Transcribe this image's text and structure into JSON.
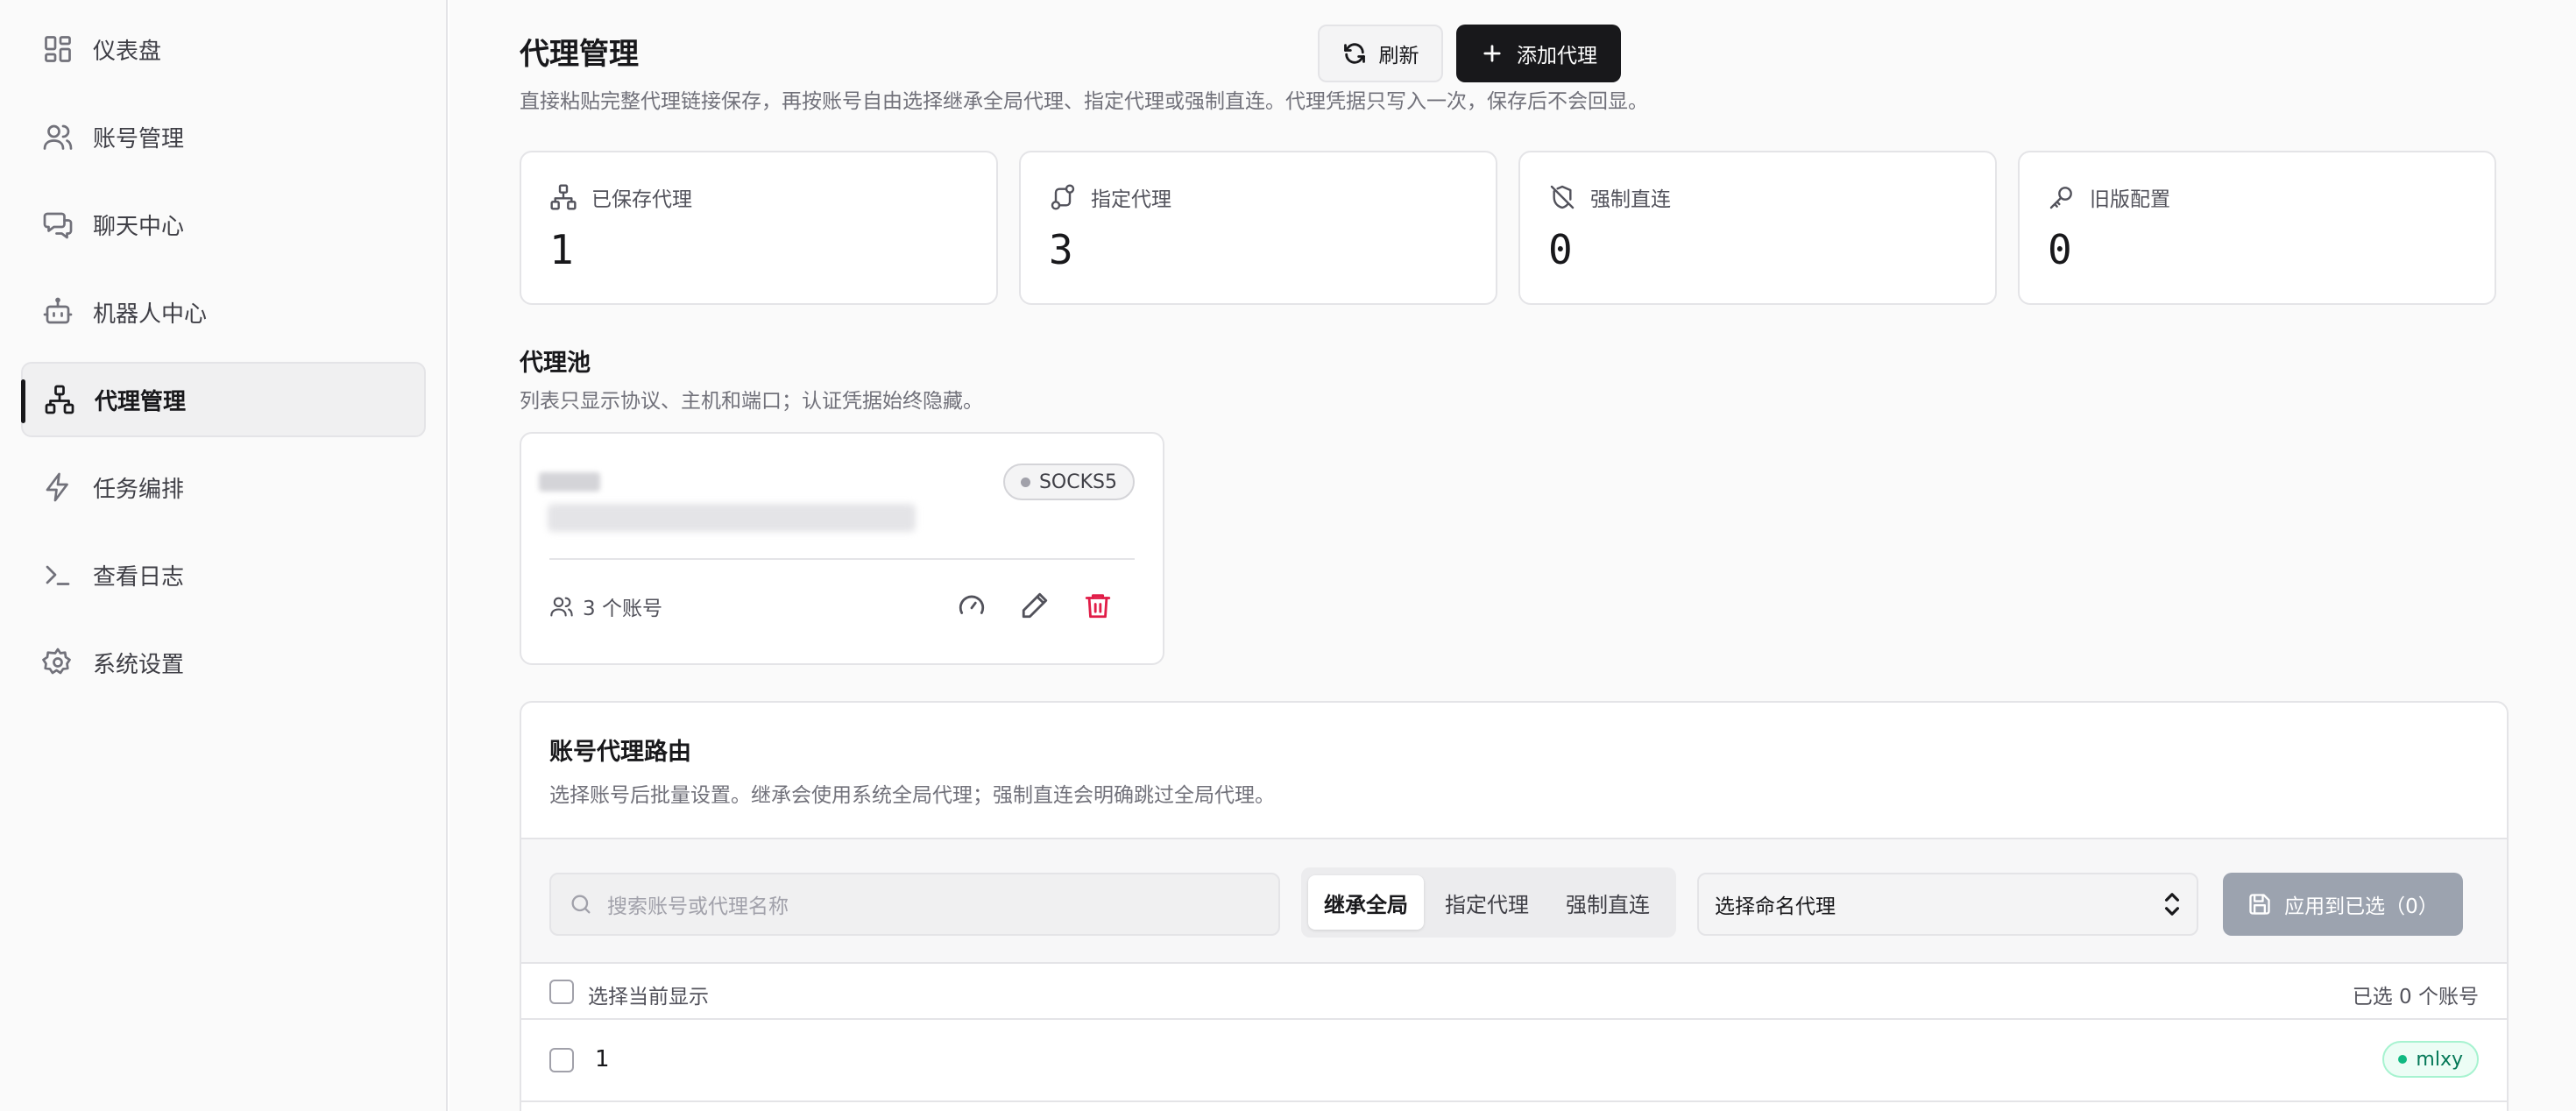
{
  "sidebar": {
    "items": [
      {
        "label": "仪表盘",
        "icon": "dashboard-icon"
      },
      {
        "label": "账号管理",
        "icon": "users-icon"
      },
      {
        "label": "聊天中心",
        "icon": "chat-icon"
      },
      {
        "label": "机器人中心",
        "icon": "bot-icon"
      },
      {
        "label": "代理管理",
        "icon": "network-icon",
        "active": true
      },
      {
        "label": "任务编排",
        "icon": "zap-icon"
      },
      {
        "label": "查看日志",
        "icon": "terminal-icon"
      },
      {
        "label": "系统设置",
        "icon": "gear-icon"
      }
    ]
  },
  "header": {
    "title": "代理管理",
    "description": "直接粘贴完整代理链接保存，再按账号自由选择继承全局代理、指定代理或强制直连。代理凭据只写入一次，保存后不会回显。",
    "refresh_label": "刷新",
    "add_label": "添加代理"
  },
  "stats": [
    {
      "label": "已保存代理",
      "value": "1",
      "icon": "network-icon"
    },
    {
      "label": "指定代理",
      "value": "3",
      "icon": "route-icon"
    },
    {
      "label": "强制直连",
      "value": "0",
      "icon": "shield-off-icon"
    },
    {
      "label": "旧版配置",
      "value": "0",
      "icon": "key-icon"
    }
  ],
  "pool": {
    "title": "代理池",
    "description": "列表只显示协议、主机和端口；认证凭据始终隐藏。",
    "cards": [
      {
        "protocol": "SOCKS5",
        "accounts": "3 个账号"
      }
    ]
  },
  "routing": {
    "title": "账号代理路由",
    "description": "选择账号后批量设置。继承会使用系统全局代理；强制直连会明确跳过全局代理。",
    "search_placeholder": "搜索账号或代理名称",
    "modes": [
      "继承全局",
      "指定代理",
      "强制直连"
    ],
    "selected_mode": "继承全局",
    "select_value": "选择命名代理",
    "apply_label": "应用到已选（0）",
    "select_all_label": "选择当前显示",
    "selected_count": "已选 0 个账号",
    "rows": [
      {
        "name": "1",
        "tag": "mlxy"
      }
    ]
  },
  "colors": {
    "primary": "#18181b",
    "danger": "#e11d48",
    "success": "#10b981",
    "disabled": "#9ca3af"
  }
}
